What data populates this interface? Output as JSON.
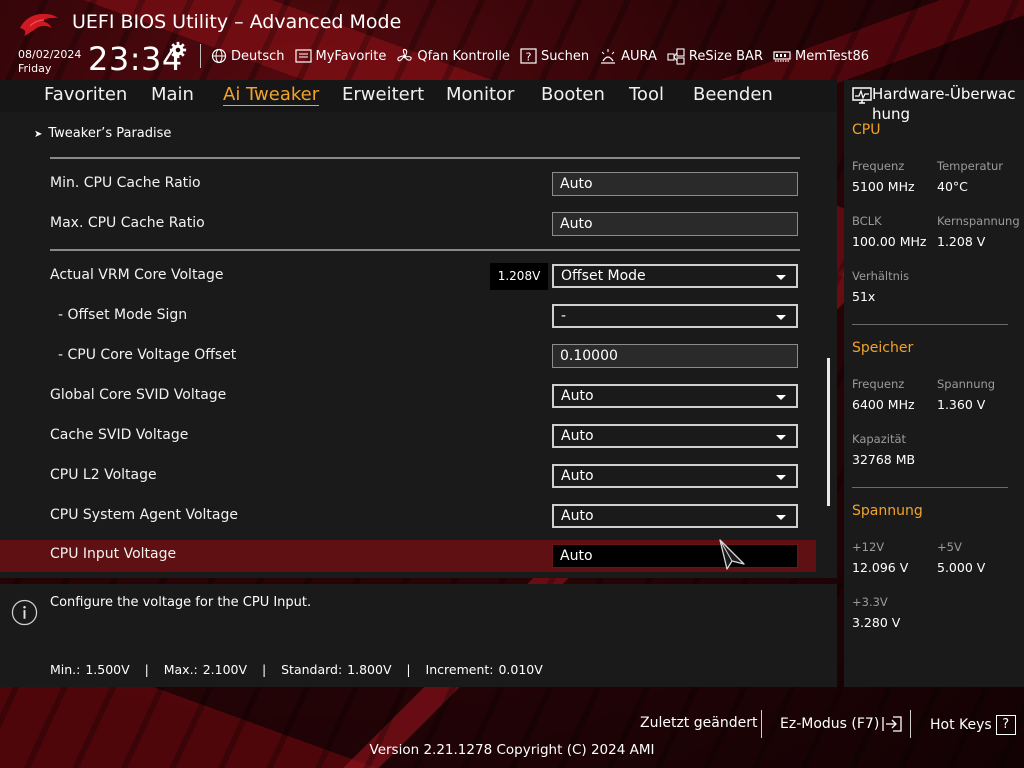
{
  "header": {
    "title": "UEFI BIOS Utility – Advanced Mode",
    "date": "08/02/2024",
    "day": "Friday",
    "time": "23:34",
    "toolbar": [
      {
        "label": "Deutsch",
        "icon": "globe-icon"
      },
      {
        "label": "MyFavorite",
        "icon": "favorite-list-icon"
      },
      {
        "label": "Qfan Kontrolle",
        "icon": "fan-icon"
      },
      {
        "label": "Suchen",
        "icon": "search-help-icon"
      },
      {
        "label": "AURA",
        "icon": "aura-light-icon"
      },
      {
        "label": "ReSize BAR",
        "icon": "resize-bar-icon"
      },
      {
        "label": "MemTest86",
        "icon": "memory-icon"
      }
    ]
  },
  "tabs": [
    "Favoriten",
    "Main",
    "Ai Tweaker",
    "Erweitert",
    "Monitor",
    "Booten",
    "Tool",
    "Beenden"
  ],
  "active_tab": "Ai Tweaker",
  "breadcrumb": "Tweaker’s Paradise",
  "settings": [
    {
      "label": "Min. CPU Cache Ratio",
      "value": "Auto",
      "type": "text"
    },
    {
      "label": "Max. CPU Cache Ratio",
      "value": "Auto",
      "type": "text"
    },
    {
      "label": "Actual VRM Core Voltage",
      "value": "Offset Mode",
      "type": "dropdown",
      "reading": "1.208V"
    },
    {
      "label": "- Offset Mode Sign",
      "value": "-",
      "type": "dropdown"
    },
    {
      "label": "- CPU Core Voltage Offset",
      "value": "0.10000",
      "type": "text"
    },
    {
      "label": "Global Core SVID Voltage",
      "value": "Auto",
      "type": "dropdown"
    },
    {
      "label": "Cache SVID Voltage",
      "value": "Auto",
      "type": "dropdown"
    },
    {
      "label": "CPU L2 Voltage",
      "value": "Auto",
      "type": "dropdown"
    },
    {
      "label": "CPU System Agent Voltage",
      "value": "Auto",
      "type": "dropdown"
    },
    {
      "label": "CPU Input Voltage",
      "value": "Auto",
      "type": "text",
      "selected": true
    }
  ],
  "help": {
    "description": "Configure the voltage for the CPU Input.",
    "specs": "Min.: 1.500V   |   Max.: 2.100V   |   Standard: 1.800V   |   Increment: 0.010V"
  },
  "hw_monitor": {
    "title": "Hardware-Überwachung",
    "title_line1": "Hardware-Überwac",
    "title_line2": "hung",
    "cpu": {
      "heading": "CPU",
      "freq_label": "Frequenz",
      "freq": "5100 MHz",
      "temp_label": "Temperatur",
      "temp": "40°C",
      "bclk_label": "BCLK",
      "bclk": "100.00 MHz",
      "vcore_label": "Kernspannung",
      "vcore": "1.208 V",
      "ratio_label": "Verhältnis",
      "ratio": "51x"
    },
    "memory": {
      "heading": "Speicher",
      "freq_label": "Frequenz",
      "freq": "6400 MHz",
      "volt_label": "Spannung",
      "volt": "1.360 V",
      "cap_label": "Kapazität",
      "cap": "32768 MB"
    },
    "voltage": {
      "heading": "Spannung",
      "v12_label": "+12V",
      "v12": "12.096 V",
      "v5_label": "+5V",
      "v5": "5.000 V",
      "v33_label": "+3.3V",
      "v33": "3.280 V"
    }
  },
  "footer": {
    "last_changed": "Zuletzt geändert",
    "ez_mode": "Ez-Modus (F7)",
    "hot_keys": "Hot Keys",
    "hot_keys_key": "?",
    "version": "Version 2.21.1278 Copyright (C) 2024 AMI"
  },
  "colors": {
    "accent": "#f2a32d",
    "selected_row": "#5e1013",
    "panel": "#1a1a1a"
  }
}
